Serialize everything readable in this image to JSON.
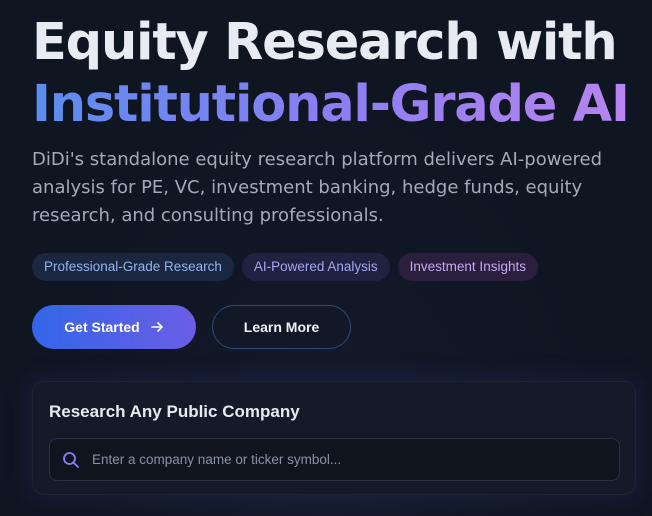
{
  "hero": {
    "title_line1": "Equity Research with",
    "title_line2": "Institutional-Grade AI",
    "description": "DiDi's standalone equity research platform delivers AI-powered analysis for PE, VC, investment banking, hedge funds, equity research, and consulting professionals."
  },
  "badges": [
    {
      "label": "Professional-Grade Research",
      "color": "#93b4ec"
    },
    {
      "label": "AI-Powered Analysis",
      "color": "#a4a7ee"
    },
    {
      "label": "Investment Insights",
      "color": "#c9a7ef"
    }
  ],
  "cta": {
    "primary_label": "Get Started",
    "primary_icon": "arrow-right-icon",
    "secondary_label": "Learn More"
  },
  "search": {
    "title": "Research Any Public Company",
    "placeholder": "Enter a company name or ticker symbol...",
    "icon": "search-icon"
  },
  "colors": {
    "background": "#0f1521",
    "accent_start": "#3366e8",
    "accent_end": "#6c5de6",
    "title_gradient": [
      "#5b8def",
      "#8b7ef2",
      "#b884f0"
    ]
  }
}
